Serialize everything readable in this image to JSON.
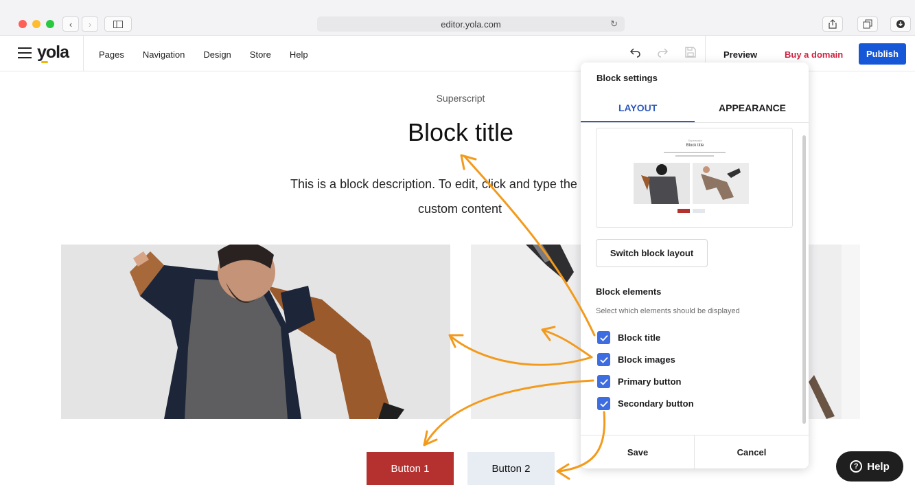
{
  "browser": {
    "url": "editor.yola.com"
  },
  "header": {
    "logo": "yola",
    "nav": [
      "Pages",
      "Navigation",
      "Design",
      "Store",
      "Help"
    ],
    "preview_label": "Preview",
    "buy_label": "Buy a domain",
    "publish_label": "Publish"
  },
  "canvas": {
    "superscript": "Superscript",
    "title": "Block title",
    "description": "This is a block description. To edit, click and type the text or re",
    "description_line2": "custom content",
    "button1": "Button 1",
    "button2": "Button 2"
  },
  "panel": {
    "title": "Block settings",
    "tabs": [
      {
        "label": "LAYOUT",
        "active": true
      },
      {
        "label": "APPEARANCE",
        "active": false
      }
    ],
    "thumbnail": {
      "superscript": "Superscript",
      "title": "Block title"
    },
    "switch_label": "Switch block layout",
    "elements_title": "Block elements",
    "elements_desc": "Select which elements should be displayed",
    "options": [
      {
        "label": "Block title",
        "checked": true
      },
      {
        "label": "Block images",
        "checked": true
      },
      {
        "label": "Primary button",
        "checked": true
      },
      {
        "label": "Secondary button",
        "checked": true
      }
    ],
    "save_label": "Save",
    "cancel_label": "Cancel"
  },
  "help_label": "Help",
  "colors": {
    "accent_blue": "#1557d6",
    "checkbox_blue": "#3d6de0",
    "buy_red": "#d11f3f",
    "button1_red": "#b53130",
    "arrow_orange": "#f39a1b"
  }
}
